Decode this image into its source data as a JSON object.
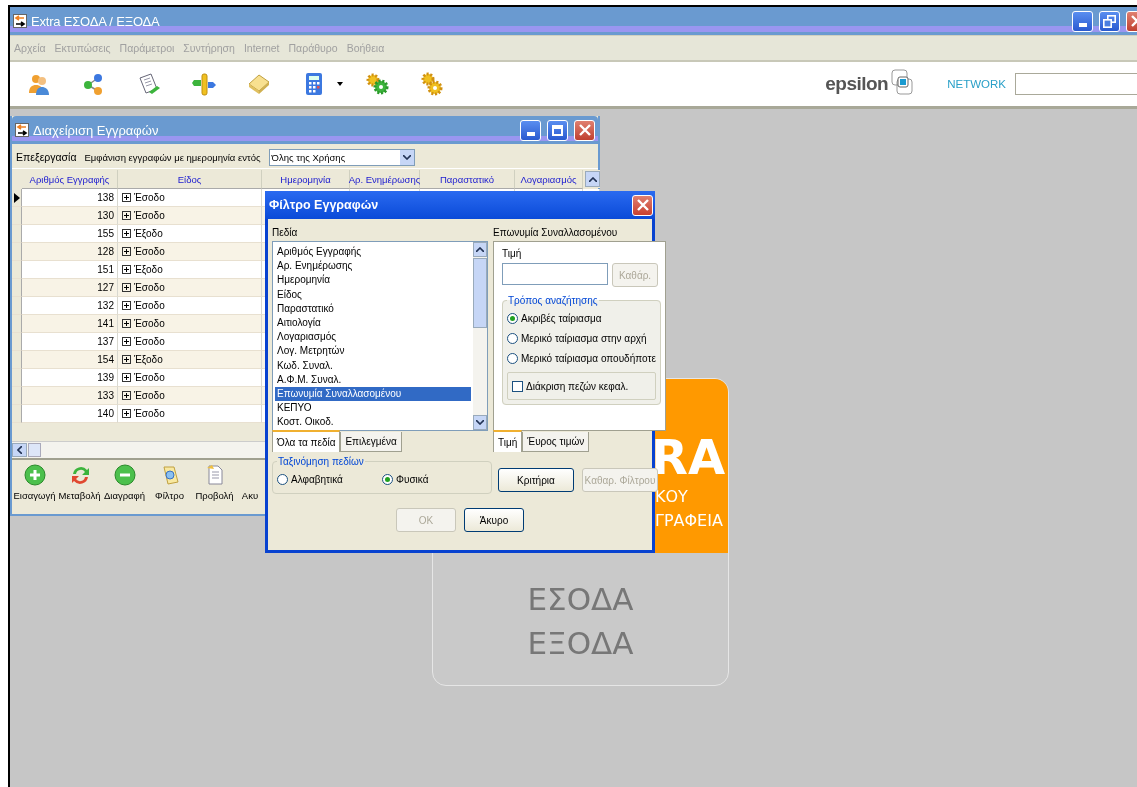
{
  "app": {
    "title": "Extra ΕΣΟΔΑ / ΕΞΟΔΑ",
    "menu": [
      {
        "label": "Αρχεία",
        "disabled": true
      },
      {
        "label": "Εκτυπώσεις",
        "disabled": true
      },
      {
        "label": "Παράμετροι",
        "disabled": true
      },
      {
        "label": "Συντήρηση",
        "disabled": true
      },
      {
        "label": "Internet",
        "disabled": true
      },
      {
        "label": "Παράθυρο",
        "disabled": true
      },
      {
        "label": "Βοήθεια",
        "disabled": true
      }
    ],
    "brand": {
      "name": "epsilon",
      "tagline": "NETWORK"
    }
  },
  "records_window": {
    "title": "Διαχείριση Εγγραφών",
    "edit_menu": "Επεξεργασία",
    "date_filter_label": "Εμφάνιση εγγραφών με ημερομηνία εντός",
    "date_filter_value": "Όλης της Χρήσης",
    "columns": [
      "Αριθμός Εγγραφής",
      "Είδος",
      "Ημερομηνία",
      "Αρ. Ενημέρωσης",
      "Παραστατικό",
      "Λογαριασμός"
    ],
    "rows": [
      {
        "number": "138",
        "kind": "Έσοδο",
        "selected": true
      },
      {
        "number": "130",
        "kind": "Έσοδο",
        "selected": false
      },
      {
        "number": "155",
        "kind": "Έξοδο",
        "selected": false
      },
      {
        "number": "128",
        "kind": "Έσοδο",
        "selected": false
      },
      {
        "number": "151",
        "kind": "Έξοδο",
        "selected": false
      },
      {
        "number": "127",
        "kind": "Έσοδο",
        "selected": false
      },
      {
        "number": "132",
        "kind": "Έσοδο",
        "selected": false
      },
      {
        "number": "141",
        "kind": "Έσοδο",
        "selected": false
      },
      {
        "number": "137",
        "kind": "Έσοδο",
        "selected": false
      },
      {
        "number": "154",
        "kind": "Έξοδο",
        "selected": false
      },
      {
        "number": "139",
        "kind": "Έσοδο",
        "selected": false
      },
      {
        "number": "133",
        "kind": "Έσοδο",
        "selected": false
      },
      {
        "number": "140",
        "kind": "Έσοδο",
        "selected": false
      }
    ],
    "actions": [
      {
        "label": "Εισαγωγή",
        "kind": "add"
      },
      {
        "label": "Μεταβολή",
        "kind": "change"
      },
      {
        "label": "Διαγραφή",
        "kind": "delete"
      },
      {
        "label": "Φίλτρο",
        "kind": "filter"
      },
      {
        "label": "Προβολή",
        "kind": "view"
      },
      {
        "label": "Ακυ",
        "kind": "cut"
      }
    ]
  },
  "filter_dialog": {
    "title": "Φίλτρο Εγγραφών",
    "fields_label": "Πεδία",
    "fields": [
      {
        "label": "Αριθμός Εγγραφής",
        "selected": false
      },
      {
        "label": "Αρ. Ενημέρωσης",
        "selected": false
      },
      {
        "label": "Ημερομηνία",
        "selected": false
      },
      {
        "label": "Είδος",
        "selected": false
      },
      {
        "label": "Παραστατικό",
        "selected": false
      },
      {
        "label": "Αιτιολογία",
        "selected": false
      },
      {
        "label": "Λογαριασμός",
        "selected": false
      },
      {
        "label": "Λογ. Μετρητών",
        "selected": false
      },
      {
        "label": "Κωδ. Συναλ.",
        "selected": false
      },
      {
        "label": "Α.Φ.Μ. Συναλ.",
        "selected": false
      },
      {
        "label": "Επωνυμία Συναλλασομένου",
        "selected": true
      },
      {
        "label": "ΚΕΠΥΟ",
        "selected": false
      },
      {
        "label": "Κοστ. Οικοδ.",
        "selected": false
      }
    ],
    "field_tabs": [
      {
        "label": "Όλα τα πεδία",
        "selected": true
      },
      {
        "label": "Επιλεγμένα",
        "selected": false
      }
    ],
    "sort_group": {
      "title": "Ταξινόμηση πεδίων",
      "options": [
        {
          "label": "Αλφαβητικά",
          "selected": false
        },
        {
          "label": "Φυσικά",
          "selected": true
        }
      ]
    },
    "field_name": "Επωνυμία Συναλλασομένου",
    "value_label": "Τιμή",
    "clear_button": {
      "label": "Καθάρ.",
      "disabled": true
    },
    "search_mode": {
      "title": "Τρόπος αναζήτησης",
      "options": [
        {
          "label": "Ακριβές ταίριασμα",
          "selected": true
        },
        {
          "label": "Μερικό ταίριασμα στην αρχή",
          "selected": false
        },
        {
          "label": "Μερικό ταίριασμα οπουδήποτε",
          "selected": false
        }
      ]
    },
    "case_sensitive": {
      "label": "Διάκριση πεζών κεφαλ.",
      "checked": false
    },
    "value_tabs": [
      {
        "label": "Τιμή",
        "selected": true
      },
      {
        "label": "Έυρος τιμών",
        "selected": false
      }
    ],
    "actions": [
      {
        "label": "Κριτήρια",
        "disabled": false
      },
      {
        "label": "Καθαρ. Φίλτρου",
        "disabled": true
      }
    ],
    "buttons": [
      {
        "label": "OK",
        "disabled": true
      },
      {
        "label": "Άκυρο",
        "disabled": false
      }
    ]
  },
  "splash": {
    "brand_lines": [
      "RA",
      "ΚΟΥ",
      "ΓΡΑΦΕΙΑ"
    ],
    "product_lines": [
      "ΕΣΟΔΑ",
      "ΕΞΟΔΑ"
    ]
  }
}
